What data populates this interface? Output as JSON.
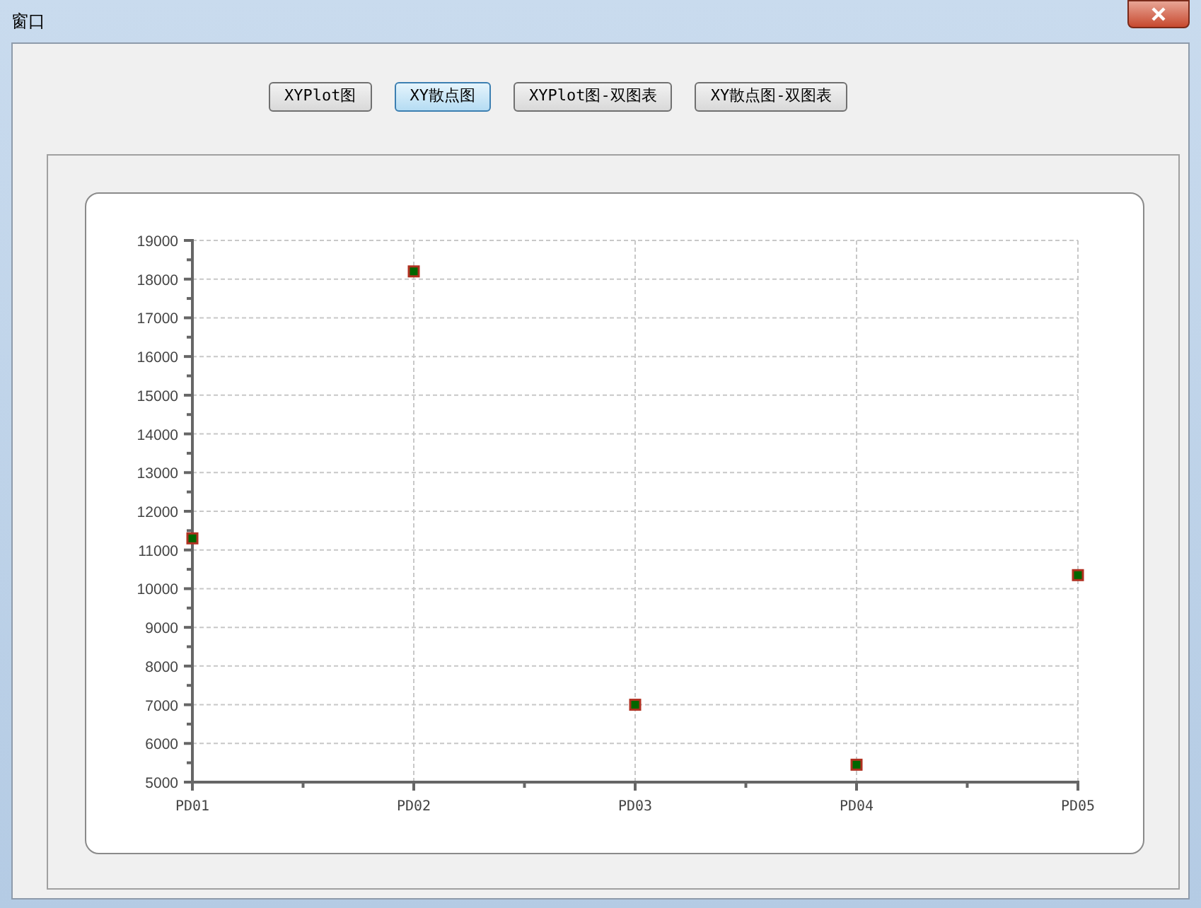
{
  "window": {
    "title": "窗口"
  },
  "buttons": [
    {
      "label": "XYPlot图",
      "selected": false
    },
    {
      "label": "XY散点图",
      "selected": true
    },
    {
      "label": "XYPlot图-双图表",
      "selected": false
    },
    {
      "label": "XY散点图-双图表",
      "selected": false
    }
  ],
  "chart_data": {
    "type": "scatter",
    "categories": [
      "PD01",
      "PD02",
      "PD03",
      "PD04",
      "PD05"
    ],
    "grid": true,
    "series": [
      {
        "color": "#006600",
        "values": [
          11300,
          18200,
          7000,
          5450,
          10350
        ]
      }
    ],
    "ylim": [
      5000,
      19000
    ],
    "yticks": [
      5000,
      6000,
      7000,
      8000,
      9000,
      10000,
      11000,
      12000,
      13000,
      14000,
      15000,
      16000,
      17000,
      18000,
      19000
    ]
  }
}
